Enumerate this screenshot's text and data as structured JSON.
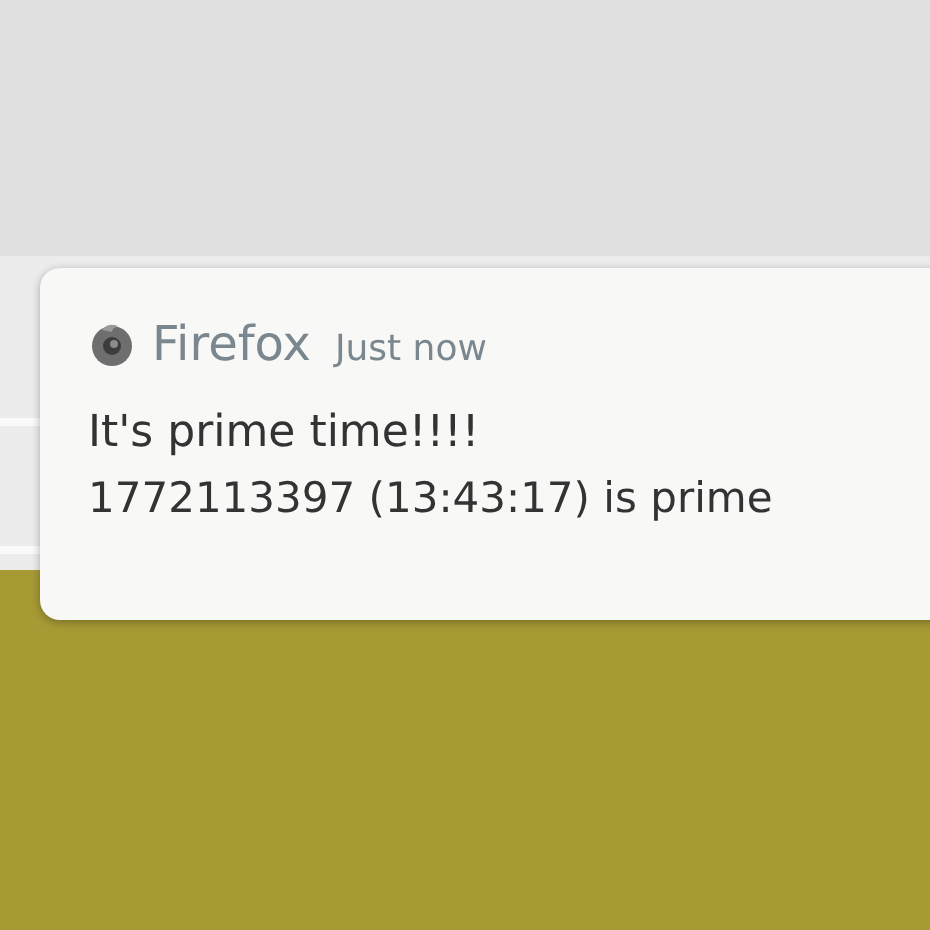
{
  "notification": {
    "app_name": "Firefox",
    "time": "Just now",
    "title": "It's prime time!!!!",
    "body": "1772113397 (13:43:17) is prime"
  }
}
